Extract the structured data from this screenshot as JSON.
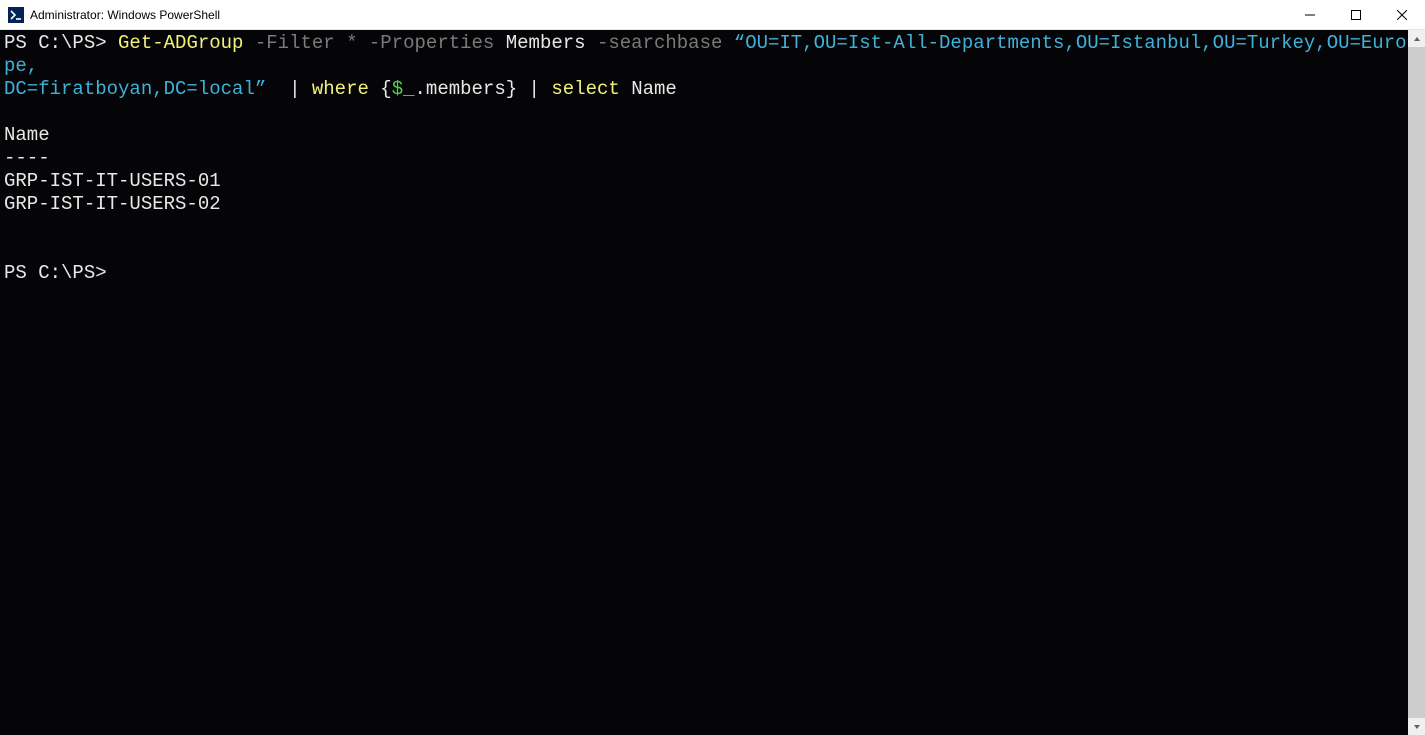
{
  "window": {
    "title": "Administrator: Windows PowerShell"
  },
  "terminal": {
    "line1": {
      "prompt": "PS C:\\PS>",
      "cmd": "Get-ADGroup",
      "flag_filter": "-Filter",
      "star": "*",
      "flag_props": "-Properties",
      "props_val": "Members",
      "flag_sb": "-searchbase",
      "sb_open": "“OU=IT,OU=Ist-All-Departments,OU=Istanbul,OU=Turkey,OU=Europe,"
    },
    "line2": {
      "sb_close": "DC=firatboyan,DC=local”",
      "pipe1": "|",
      "where_kw": "where",
      "brace_open": "{",
      "dollar": "$_",
      "members": ".members",
      "brace_close": "}",
      "pipe2": "|",
      "select_kw": "select",
      "select_arg": "Name"
    },
    "blank": "",
    "header": "Name",
    "divider": "----",
    "rows": [
      "GRP-IST-IT-USERS-01",
      "GRP-IST-IT-USERS-02"
    ],
    "prompt2": "PS C:\\PS>"
  }
}
